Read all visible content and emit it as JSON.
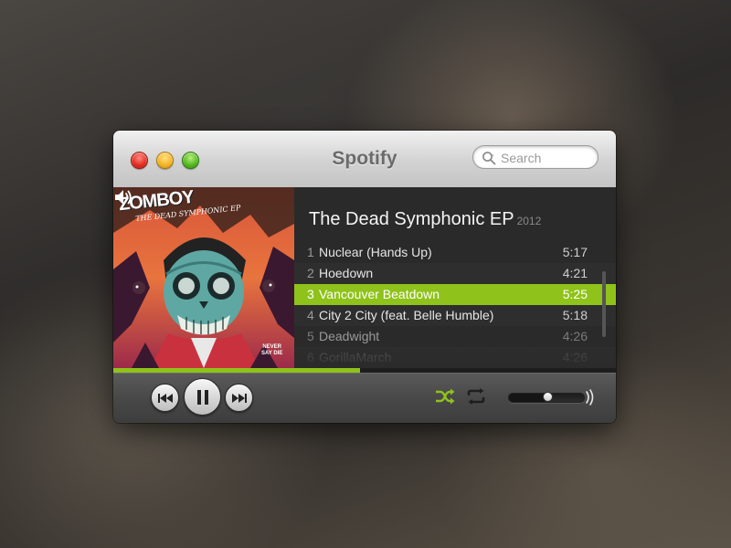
{
  "window": {
    "title": "Spotify"
  },
  "search": {
    "placeholder": "Search",
    "value": ""
  },
  "album": {
    "title": "The Dead Symphonic EP",
    "year": "2012",
    "art_artist": "ZOMBOY",
    "art_subtitle": "THE DEAD SYMPHONIC EP",
    "art_badge_line1": "NEVER",
    "art_badge_line2": "SAY DIE"
  },
  "tracks": [
    {
      "num": "1",
      "name": "Nuclear (Hands Up)",
      "duration": "5:17"
    },
    {
      "num": "2",
      "name": "Hoedown",
      "duration": "4:21"
    },
    {
      "num": "3",
      "name": "Vancouver Beatdown",
      "duration": "5:25",
      "playing": true
    },
    {
      "num": "4",
      "name": "City 2 City (feat. Belle Humble)",
      "duration": "5:18"
    },
    {
      "num": "5",
      "name": "Deadwight",
      "duration": "4:26"
    },
    {
      "num": "6",
      "name": "GorillaMarch",
      "duration": "4:26"
    }
  ],
  "playback": {
    "progress": 0.49,
    "state": "playing",
    "shuffle": true,
    "repeat": false,
    "volume": 0.52
  },
  "colors": {
    "accent": "#8fc21b",
    "tracklist_bg": "#2a2a2a",
    "close": "#e0291f",
    "minimize": "#f2b321",
    "zoom": "#4fb51c"
  },
  "icons": {
    "now_playing": "speaker-icon",
    "search": "search-icon",
    "prev": "previous-track-icon",
    "pause": "pause-icon",
    "next": "next-track-icon",
    "shuffle": "shuffle-icon",
    "repeat": "repeat-icon",
    "volume": "volume-icon"
  }
}
